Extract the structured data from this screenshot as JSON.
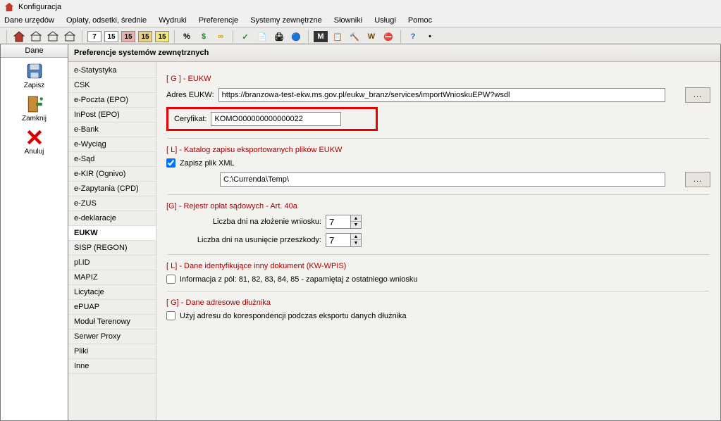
{
  "window": {
    "title": "Konfiguracja"
  },
  "menu": [
    "Dane urzędów",
    "Opłaty, odsetki, średnie",
    "Wydruki",
    "Preferencje",
    "Systemy zewnętrzne",
    "Słowniki",
    "Usługi",
    "Pomoc"
  ],
  "toolbar_numbers": [
    "7",
    "15",
    "15",
    "15",
    "15"
  ],
  "toolbar_icons": [
    "%",
    "$",
    "∞",
    "✓",
    "📄",
    "🖨",
    "🔵",
    "M",
    "📋",
    "🔨",
    "W",
    "⛔",
    "?",
    "•"
  ],
  "leftbar": {
    "header": "Dane",
    "zapisz": "Zapisz",
    "zamknij": "Zamknij",
    "anuluj": "Anuluj"
  },
  "panel_title": "Preferencje systemów zewnętrznych",
  "categories": [
    "e-Statystyka",
    "CSK",
    "e-Poczta (EPO)",
    "InPost (EPO)",
    "e-Bank",
    "e-Wyciąg",
    "e-Sąd",
    "e-KIR (Ognivo)",
    "e-Zapytania (CPD)",
    "e-ZUS",
    "e-deklaracje",
    "EUKW",
    "SISP (REGON)",
    "pl.ID",
    "MAPIZ",
    "Licytacje",
    "ePUAP",
    "Moduł Terenowy",
    "Serwer Proxy",
    "Pliki",
    "Inne"
  ],
  "selected_category": "EUKW",
  "sections": {
    "g_eukw": "[ G ] - EUKW",
    "adres_label": "Adres EUKW:",
    "adres_value": "https://branzowa-test-ekw.ms.gov.pl/eukw_branz/services/importWnioskuEPW?wsdl",
    "cert_label": "Ceryfikat:",
    "cert_value": "KOMO000000000000022",
    "l_katalog": "[ L] - Katalog zapisu eksportowanych plików EUKW",
    "zapisz_xml": "Zapisz plik XML",
    "katalog_path": "C:\\Currenda\\Temp\\",
    "g_rejestr": "[G] - Rejestr opłat sądowych - Art. 40a",
    "dni_zlozenie_label": "Liczba dni na złożenie wniosku:",
    "dni_zlozenie_value": "7",
    "dni_przeszkody_label": "Liczba dni na usunięcie przeszkody:",
    "dni_przeszkody_value": "7",
    "l_dane_identyf": "[ L] - Dane identyfikujące inny dokument (KW-WPIS)",
    "informacja_pol": "Informacja z pól: 81, 82, 83, 84, 85 - zapamiętaj z ostatniego wniosku",
    "g_dane_adresowe": "[ G] - Dane adresowe dłużnika",
    "uzyj_adresu": "Użyj adresu do korespondencji podczas eksportu danych dłużnika",
    "ellipsis": "..."
  }
}
